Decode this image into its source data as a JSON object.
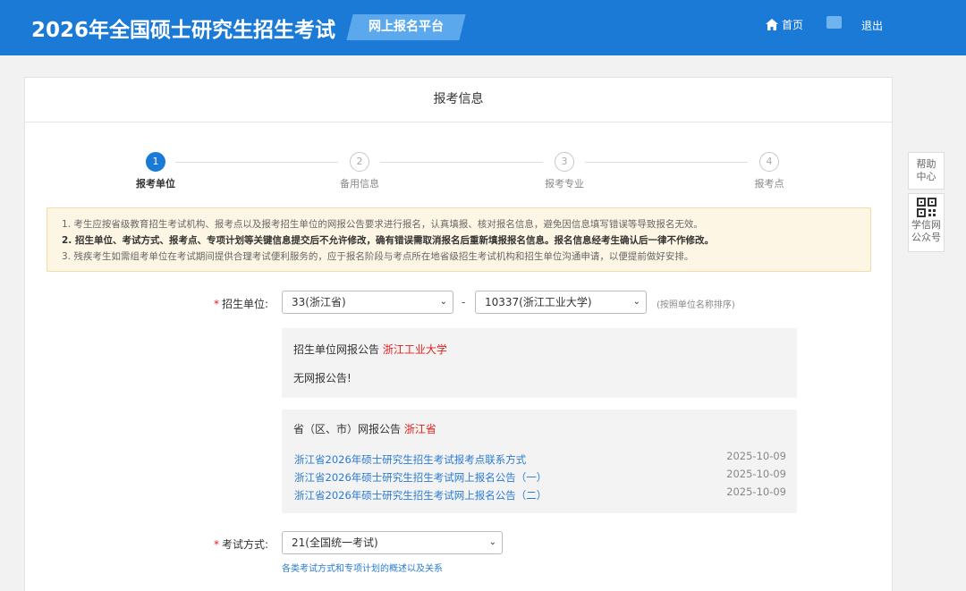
{
  "header": {
    "title": "2026年全国硕士研究生招生考试",
    "platform": "网上报名平台",
    "home": "首页",
    "logout": "退出"
  },
  "panel": {
    "title": "报考信息"
  },
  "steps": [
    {
      "num": "1",
      "label": "报考单位",
      "active": true
    },
    {
      "num": "2",
      "label": "备用信息",
      "active": false
    },
    {
      "num": "3",
      "label": "报考专业",
      "active": false
    },
    {
      "num": "4",
      "label": "报考点",
      "active": false
    }
  ],
  "notice": {
    "line1": "1. 考生应按省级教育招生考试机构、报考点以及报考招生单位的网报公告要求进行报名，认真填报、核对报名信息，避免因信息填写错误等导致报名无效。",
    "line2": "2. 招生单位、考试方式、报考点、专项计划等关键信息提交后不允许修改，确有错误需取消报名后重新填报报名信息。报名信息经考生确认后一律不作修改。",
    "line3": "3. 残疾考生如需组考单位在考试期间提供合理考试便利服务的，应于报名阶段与考点所在地省级招生考试机构和招生单位沟通申请，以便提前做好安排。"
  },
  "form": {
    "unit_label": "招生单位:",
    "province_select": "33(浙江省)",
    "school_select": "10337(浙江工业大学)",
    "separator": "-",
    "sort_hint": "(按照单位名称排序)",
    "exam_label": "考试方式:",
    "exam_select": "21(全国统一考试)",
    "exam_link": "各类考试方式和专项计划的概述以及关系"
  },
  "unit_notice": {
    "title_prefix": "招生单位网报公告",
    "title_name": "浙江工业大学",
    "empty": "无网报公告!"
  },
  "province_notice": {
    "title_prefix": "省（区、市）网报公告",
    "title_name": "浙江省",
    "items": [
      {
        "text": "浙江省2026年硕士研究生招生考试报考点联系方式",
        "date": "2025-10-09"
      },
      {
        "text": "浙江省2026年硕士研究生招生考试网上报名公告（一）",
        "date": "2025-10-09"
      },
      {
        "text": "浙江省2026年硕士研究生招生考试网上报名公告（二）",
        "date": "2025-10-09"
      }
    ]
  },
  "side": {
    "help_line1": "帮助",
    "help_line2": "中心",
    "wechat_line1": "学信网",
    "wechat_line2": "公众号"
  },
  "colors": {
    "header_bg": "#1a7ad6",
    "accent": "#1a7ad6",
    "link": "#2b7bd1",
    "required": "#e02020"
  }
}
